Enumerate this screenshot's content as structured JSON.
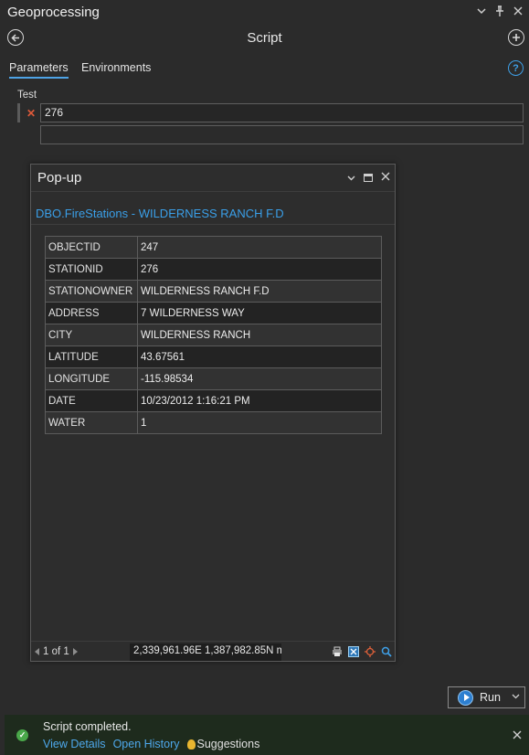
{
  "pane": {
    "title": "Geoprocessing"
  },
  "tool": {
    "title": "Script"
  },
  "tabs": [
    {
      "label": "Parameters",
      "active": true
    },
    {
      "label": "Environments",
      "active": false
    }
  ],
  "parameter": {
    "label": "Test",
    "value": "276",
    "empty_value": ""
  },
  "popup": {
    "title": "Pop-up",
    "feature_title": "DBO.FireStations - WILDERNESS RANCH F.D",
    "attributes": [
      {
        "key": "OBJECTID",
        "value": "247"
      },
      {
        "key": "STATIONID",
        "value": "276"
      },
      {
        "key": "STATIONOWNER",
        "value": "WILDERNESS RANCH F.D"
      },
      {
        "key": "ADDRESS",
        "value": "7 WILDERNESS WAY"
      },
      {
        "key": "CITY",
        "value": "WILDERNESS RANCH"
      },
      {
        "key": "LATITUDE",
        "value": "43.67561"
      },
      {
        "key": "LONGITUDE",
        "value": "-115.98534"
      },
      {
        "key": "DATE",
        "value": "10/23/2012 1:16:21 PM"
      },
      {
        "key": "WATER",
        "value": "1"
      }
    ],
    "pager": "1 of 1",
    "coordinates": "2,339,961.96E 1,387,982.85N m"
  },
  "run_button": {
    "label": "Run"
  },
  "message": {
    "text": "Script completed.",
    "view_details": "View Details",
    "open_history": "Open History",
    "suggestions": "Suggestions"
  },
  "colors": {
    "accent": "#3a9fe8",
    "success": "#4aa84a",
    "error": "#e05a3a"
  }
}
